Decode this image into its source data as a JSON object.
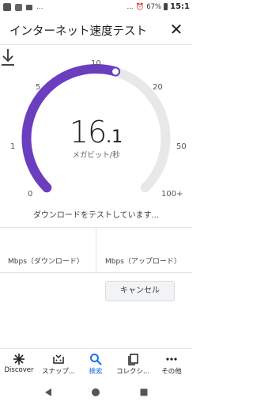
{
  "status_bar": {
    "dots_left": "...",
    "dots_right": "...",
    "battery": "67%",
    "time": "15:1"
  },
  "header": {
    "title": "インターネット速度テスト",
    "close_icon": "close-icon"
  },
  "gauge": {
    "ticks": [
      "0",
      "1",
      "5",
      "10",
      "20",
      "50",
      "100+"
    ],
    "speed_whole": "16",
    "speed_decimal": ".1",
    "unit": "メガビット/秒",
    "progress_fraction": 0.56,
    "colors": {
      "fill": "#6a3ebf",
      "track": "#e8e8e8"
    }
  },
  "status_text": "ダウンロードをテストしています...",
  "results": {
    "download_label": "Mbps（ダウンロード）",
    "upload_label": "Mbps（アップロード）"
  },
  "cancel_label": "キャンセル",
  "bottom_nav": {
    "items": [
      {
        "label": "Discover",
        "icon": "asterisk-icon"
      },
      {
        "label": "スナップ...",
        "icon": "snapshot-icon"
      },
      {
        "label": "検索",
        "icon": "search-icon"
      },
      {
        "label": "コレクシ...",
        "icon": "collections-icon"
      },
      {
        "label": "その他",
        "icon": "more-icon"
      }
    ],
    "active_index": 2,
    "accent": "#1a73e8"
  }
}
